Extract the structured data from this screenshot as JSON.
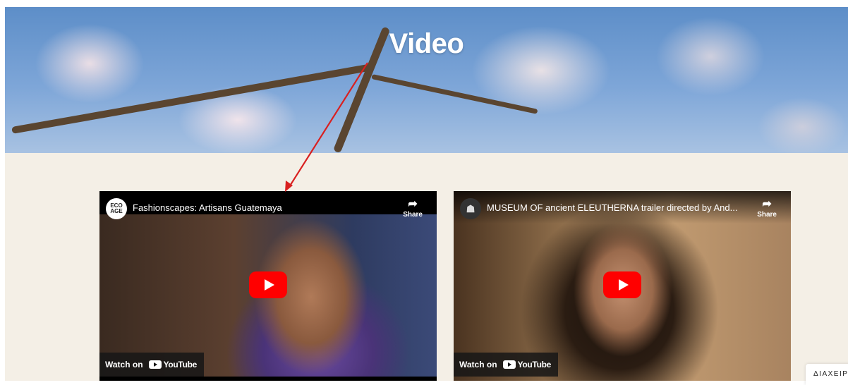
{
  "hero": {
    "title": "Video"
  },
  "videos": [
    {
      "channel_logo_text": "ECO AGE",
      "title": "Fashionscapes: Artisans Guatemaya",
      "share_label": "Share",
      "watch_on_label": "Watch on",
      "youtube_label": "YouTube"
    },
    {
      "channel_logo_text": "☗",
      "title": "MUSEUM OF ancient ELEUTHERNA trailer directed by And...",
      "share_label": "Share",
      "watch_on_label": "Watch on",
      "youtube_label": "YouTube"
    }
  ],
  "admin_tab": {
    "label": "ΔΙΑΧΕΙΡ"
  },
  "colors": {
    "page_bg": "#f4efe6",
    "annotation_arrow": "#d92020",
    "youtube_red": "#ff0000"
  }
}
